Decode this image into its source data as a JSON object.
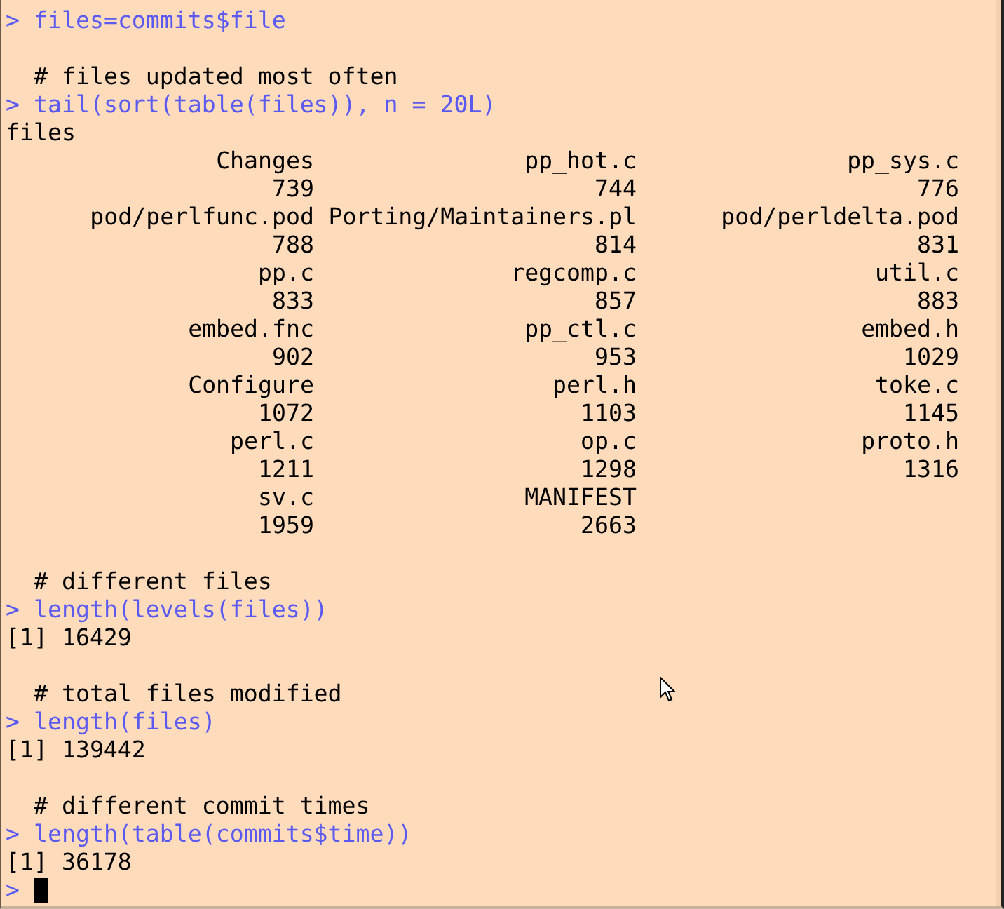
{
  "console": {
    "lines": [
      {
        "kind": "input",
        "prompt": ">",
        "text": "files=commits$file"
      },
      {
        "kind": "blank"
      },
      {
        "kind": "comment",
        "text": "# files updated most often"
      },
      {
        "kind": "input",
        "prompt": ">",
        "text": "tail(sort(table(files)), n = 20L)"
      },
      {
        "kind": "output",
        "text": "files"
      },
      {
        "kind": "table",
        "rows": [
          [
            {
              "name": "Changes",
              "count": "739"
            },
            {
              "name": "pp_hot.c",
              "count": "744"
            },
            {
              "name": "pp_sys.c",
              "count": "776"
            }
          ],
          [
            {
              "name": "pod/perlfunc.pod",
              "count": "788"
            },
            {
              "name": "Porting/Maintainers.pl",
              "count": "814"
            },
            {
              "name": "pod/perldelta.pod",
              "count": "831"
            }
          ],
          [
            {
              "name": "pp.c",
              "count": "833"
            },
            {
              "name": "regcomp.c",
              "count": "857"
            },
            {
              "name": "util.c",
              "count": "883"
            }
          ],
          [
            {
              "name": "embed.fnc",
              "count": "902"
            },
            {
              "name": "pp_ctl.c",
              "count": "953"
            },
            {
              "name": "embed.h",
              "count": "1029"
            }
          ],
          [
            {
              "name": "Configure",
              "count": "1072"
            },
            {
              "name": "perl.h",
              "count": "1103"
            },
            {
              "name": "toke.c",
              "count": "1145"
            }
          ],
          [
            {
              "name": "perl.c",
              "count": "1211"
            },
            {
              "name": "op.c",
              "count": "1298"
            },
            {
              "name": "proto.h",
              "count": "1316"
            }
          ],
          [
            {
              "name": "sv.c",
              "count": "1959"
            },
            {
              "name": "MANIFEST",
              "count": "2663"
            }
          ]
        ]
      },
      {
        "kind": "blank"
      },
      {
        "kind": "comment",
        "text": "# different files"
      },
      {
        "kind": "input",
        "prompt": ">",
        "text": "length(levels(files))"
      },
      {
        "kind": "output",
        "text": "[1] 16429"
      },
      {
        "kind": "blank"
      },
      {
        "kind": "comment",
        "text": "# total files modified"
      },
      {
        "kind": "input",
        "prompt": ">",
        "text": "length(files)"
      },
      {
        "kind": "output",
        "text": "[1] 139442"
      },
      {
        "kind": "blank"
      },
      {
        "kind": "comment",
        "text": "# different commit times"
      },
      {
        "kind": "input",
        "prompt": ">",
        "text": "length(table(commits$time))"
      },
      {
        "kind": "output",
        "text": "[1] 36178"
      },
      {
        "kind": "prompt",
        "prompt": ">"
      }
    ]
  }
}
